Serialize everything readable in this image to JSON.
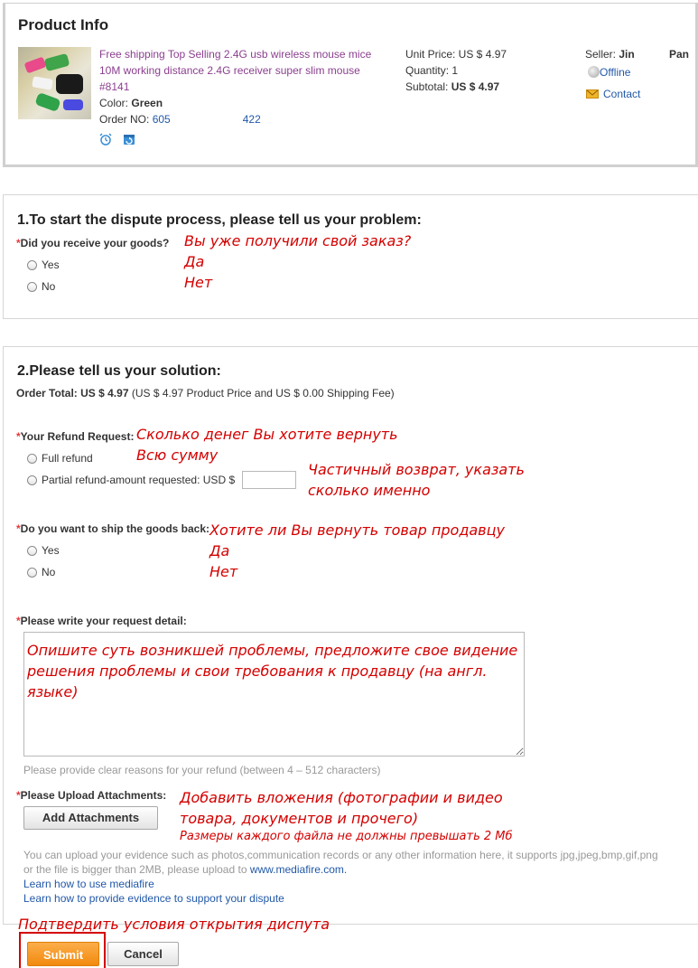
{
  "product_info": {
    "title": "Product Info",
    "product_name_line1": "Free shipping Top Selling 2.4G usb wireless mouse mice",
    "product_name_line2": "10M working distance 2.4G receiver super slim mouse",
    "product_name_line3": "#8141",
    "color_label": "Color:",
    "color_value": "Green",
    "order_no_label": "Order NO:",
    "order_no_value_a": "605",
    "order_no_value_b": "422",
    "unit_price": "Unit Price: US $ 4.97",
    "quantity": "Quantity: 1",
    "subtotal_label": "Subtotal:",
    "subtotal_value": "US $ 4.97",
    "seller_label": "Seller:",
    "seller_value_a": "Jin",
    "seller_value_b": "Pan",
    "offline": "Offline",
    "contact": "Contact"
  },
  "section1": {
    "heading": "1.To start the dispute process, please tell us your problem:",
    "question": "Did you receive your goods?",
    "options": [
      "Yes",
      "No"
    ],
    "annotations": [
      "Вы уже получили свой заказ?",
      "Да",
      "Нет"
    ]
  },
  "section2": {
    "heading": "2.Please tell us your solution:",
    "order_total_label": "Order Total:",
    "order_total_value": "US $ 4.97",
    "order_total_note": "(US $ 4.97 Product Price and US $ 0.00 Shipping Fee)",
    "refund_label": "Your Refund Request:",
    "refund_full": "Full refund",
    "refund_partial": "Partial refund-amount requested: USD $",
    "refund_amount_value": "",
    "refund_annotations": [
      "Сколько денег Вы хотите вернуть",
      "Всю сумму",
      "Частичный возврат, указать",
      "сколько именно"
    ],
    "ship_label": "Do you want to ship the goods back:",
    "ship_options": [
      "Yes",
      "No"
    ],
    "ship_annotations": [
      "Хотите ли Вы вернуть товар продавцу",
      "Да",
      "Нет"
    ],
    "detail_label": "Please write your request detail:",
    "detail_annotation_lines": [
      "Опишите суть возникшей проблемы, предложите свое видение",
      "решения проблемы и свои требования к продавцу (на англ.",
      "языке)"
    ],
    "detail_hint": "Please provide clear reasons for your refund (between 4 – 512 characters)",
    "attach_label": "Please Upload Attachments:",
    "attach_button": "Add Attachments",
    "attach_annotations": [
      "Добавить вложения (фотографии и видео",
      "товара, документов и прочего)",
      "Размеры каждого файла не должны превышать 2 Мб"
    ],
    "attach_info_line1": "You can upload your evidence such as photos,communication records or any other information here, it supports jpg,jpeg,bmp,gif,png",
    "attach_info_line2": "or the file is bigger than 2MB, please upload to",
    "mediafire_link": "www.mediafire.com.",
    "learn_link1": "Learn how to use mediafire",
    "learn_link2": "Learn how to provide evidence to support your dispute"
  },
  "footer": {
    "annotation": "Подтвердить условия открытия диспута",
    "submit": "Submit",
    "cancel": "Cancel"
  },
  "colors": {
    "annotation": "#d40000",
    "required": "#e4393c",
    "link": "#2158a8",
    "submit_bg": "#f7931e"
  }
}
